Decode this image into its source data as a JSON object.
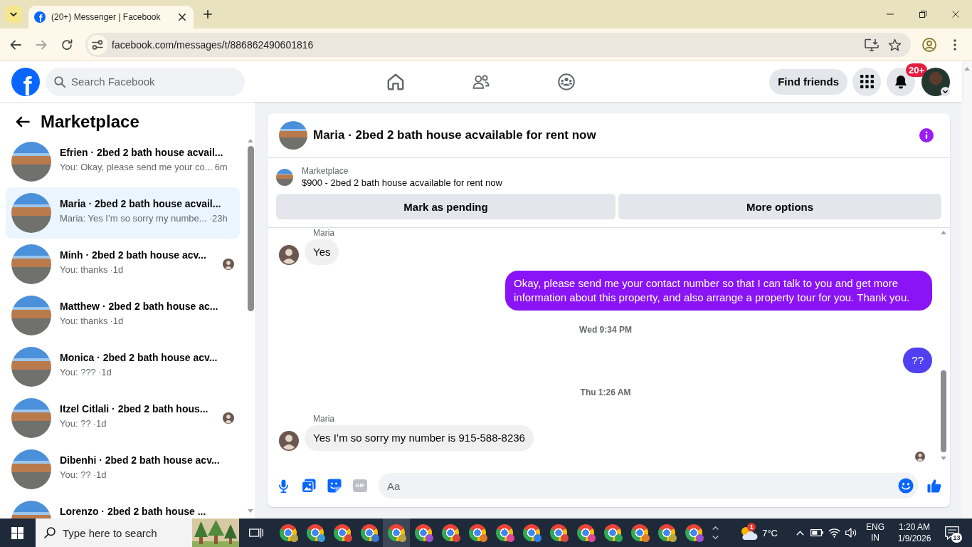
{
  "browser": {
    "favicon": "f",
    "tab_title": "(20+) Messenger | Facebook",
    "nav_buttons": [
      {
        "kind": "back",
        "disabled": false
      },
      {
        "kind": "forward",
        "disabled": true
      },
      {
        "kind": "reload",
        "disabled": false
      }
    ],
    "url": "facebook.com/messages/t/886862490601816"
  },
  "header": {
    "logo": "f",
    "search": {
      "placeholder": "Search Facebook"
    },
    "nav": [
      {
        "kind": "home",
        "selected": false
      },
      {
        "kind": "friends",
        "selected": false
      },
      {
        "kind": "groups",
        "selected": false
      }
    ],
    "find_friends": "Find friends",
    "notification_count": "20+"
  },
  "sidebar": {
    "title": "Marketplace",
    "conversations": [
      {
        "title": "Efrien · 2bed 2 bath house acvail...",
        "preview": "You: Okay, please send me your co...",
        "time": "6m",
        "selected": false,
        "read_receipt": false
      },
      {
        "title": "Maria · 2bed 2 bath house acvail...",
        "preview": "Maria: Yes I’m so sorry my numbe...",
        "time": "·23h",
        "selected": true,
        "read_receipt": false
      },
      {
        "title": "Minh · 2bed 2 bath house acv...",
        "preview": "You: thanks",
        "time": "·1d",
        "selected": false,
        "read_receipt": true
      },
      {
        "title": "Matthew · 2bed 2 bath house ac...",
        "preview": "You: thanks",
        "time": "·1d",
        "selected": false,
        "read_receipt": false
      },
      {
        "title": "Monica · 2bed 2 bath house acv...",
        "preview": "You: ???",
        "time": "·1d",
        "selected": false,
        "read_receipt": false
      },
      {
        "title": "Itzel Citlali · 2bed 2 bath hous...",
        "preview": "You: ??",
        "time": "·1d",
        "selected": false,
        "read_receipt": true
      },
      {
        "title": "Dibenhi · 2bed 2 bath house acv...",
        "preview": "You: ??",
        "time": "·1d",
        "selected": false,
        "read_receipt": false
      },
      {
        "title": "Lorenzo · 2bed 2 bath house ...",
        "selected": false,
        "read_receipt": false
      }
    ]
  },
  "chat": {
    "title": "Maria · 2bed 2 bath house acvailable for rent now",
    "listing": {
      "source": "Marketplace",
      "summary": "$900 - 2bed 2 bath house acvailable for rent now"
    },
    "actions": [
      "Mark as pending",
      "More options"
    ],
    "messages": [
      {
        "kind": "sender",
        "text": "Maria"
      },
      {
        "kind": "incoming",
        "text": "Yes"
      },
      {
        "kind": "outgoing",
        "text": "Okay, please send me your contact number so that I can talk to you and get more information about this property, and also arrange a property tour for you. Thank you.",
        "color": "#8a14f5"
      },
      {
        "kind": "timestamp",
        "text": "Wed 9:34 PM"
      },
      {
        "kind": "outgoing",
        "text": "??",
        "color": "#5040f2"
      },
      {
        "kind": "timestamp",
        "text": "Thu 1:26 AM"
      },
      {
        "kind": "sender",
        "text": "Maria"
      },
      {
        "kind": "incoming",
        "text": "Yes I’m so sorry my number is 915-588-8236"
      }
    ],
    "seen": true,
    "composer": {
      "tools": [
        {
          "kind": "mic"
        },
        {
          "kind": "photo"
        },
        {
          "kind": "sticker"
        },
        {
          "kind": "gif",
          "label": "GIF"
        }
      ],
      "placeholder": "Aa"
    }
  },
  "taskbar": {
    "search": {
      "placeholder": "Type here to search"
    },
    "apps": [
      {
        "selected": false,
        "color": "#b8a640"
      },
      {
        "selected": false,
        "color": "#3a9bd6"
      },
      {
        "selected": false,
        "color": "#d9463f"
      },
      {
        "selected": false,
        "color": "#3a78d6"
      },
      {
        "selected": true,
        "color": "#b8a640"
      },
      {
        "selected": false,
        "color": "#9b4fd1"
      },
      {
        "selected": false,
        "color": "#d9463f"
      },
      {
        "selected": false,
        "color": "#e07b2a"
      },
      {
        "selected": false,
        "color": "#e0479a"
      },
      {
        "selected": false,
        "color": "#2f80ed"
      },
      {
        "selected": false,
        "color": "#d9463f"
      },
      {
        "selected": false,
        "color": "#e0479a"
      },
      {
        "selected": false,
        "color": "#2fa55a"
      },
      {
        "selected": false,
        "color": "#e07b2a"
      },
      {
        "selected": false,
        "color": "#b8a640"
      },
      {
        "selected": false,
        "color": "#9b4fd1"
      }
    ],
    "weather": {
      "alert_count": "1",
      "temperature": "7°C"
    },
    "language": {
      "code": "ENG",
      "region": "IN"
    },
    "clock": {
      "time": "1:20 AM",
      "date": "1/9/2026"
    },
    "notification_count": "13"
  }
}
